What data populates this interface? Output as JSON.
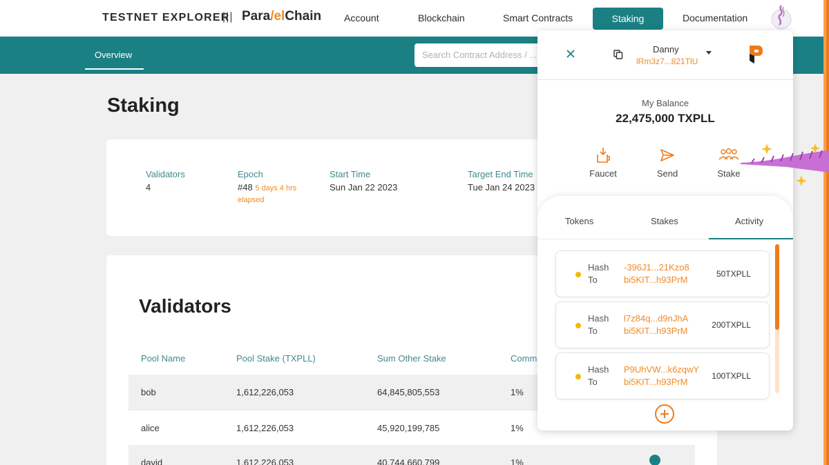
{
  "brand": {
    "title": "TESTNET EXPLORER",
    "separator": "|||",
    "logo_part1": "Para",
    "logo_part2": "/el",
    "logo_part3": "Chain"
  },
  "nav": {
    "account": "Account",
    "blockchain": "Blockchain",
    "smart_contracts": "Smart Contracts",
    "staking": "Staking",
    "documentation": "Documentation"
  },
  "subnav": {
    "overview": "Overview",
    "search_placeholder": "Search Contract Address / ..."
  },
  "page": {
    "title": "Staking"
  },
  "stats": {
    "validators_label": "Validators",
    "validators_value": "4",
    "epoch_label": "Epoch",
    "epoch_value": "#48",
    "epoch_extra": "5 days 4 hrs",
    "epoch_extra2": "elapsed",
    "start_label": "Start Time",
    "start_value": "Sun Jan 22 2023",
    "end_label": "Target End Time",
    "end_value": "Tue Jan 24 2023"
  },
  "validators": {
    "title": "Validators",
    "headers": {
      "pool_name": "Pool Name",
      "pool_stake": "Pool Stake (TXPLL)",
      "sum_other": "Sum Other Stake",
      "commission": "Comm"
    },
    "rows": [
      {
        "name": "bob",
        "pool_stake": "1,612,226,053",
        "sum_other": "64,845,805,553",
        "commission": "1%"
      },
      {
        "name": "alice",
        "pool_stake": "1,612,226,053",
        "sum_other": "45,920,199,785",
        "commission": "1%"
      },
      {
        "name": "david",
        "pool_stake": "1,612,226,053",
        "sum_other": "40,744,660,799",
        "commission": "1%"
      }
    ]
  },
  "wallet": {
    "account_name": "Danny",
    "address": "lRm3z7...821TlU",
    "balance_label": "My Balance",
    "balance_value": "22,475,000 TXPLL",
    "actions": {
      "faucet": "Faucet",
      "send": "Send",
      "stake": "Stake"
    },
    "tabs": {
      "tokens": "Tokens",
      "stakes": "Stakes",
      "activity": "Activity"
    },
    "activity": [
      {
        "hash_label": "Hash",
        "to_label": "To",
        "hash": "-396J1...21Kzo8",
        "to": "bi5KIT...h93PrM",
        "amount": "50TXPLL"
      },
      {
        "hash_label": "Hash",
        "to_label": "To",
        "hash": "l7z84q...d9nJhA",
        "to": "bi5KIT...h93PrM",
        "amount": "200TXPLL"
      },
      {
        "hash_label": "Hash",
        "to_label": "To",
        "hash": "P9UhVW...k6zqwY",
        "to": "bi5KIT...h93PrM",
        "amount": "100TXPLL"
      }
    ]
  },
  "colors": {
    "teal": "#1a8083",
    "orange": "#f08a24",
    "status_dot": "#f5b800"
  }
}
